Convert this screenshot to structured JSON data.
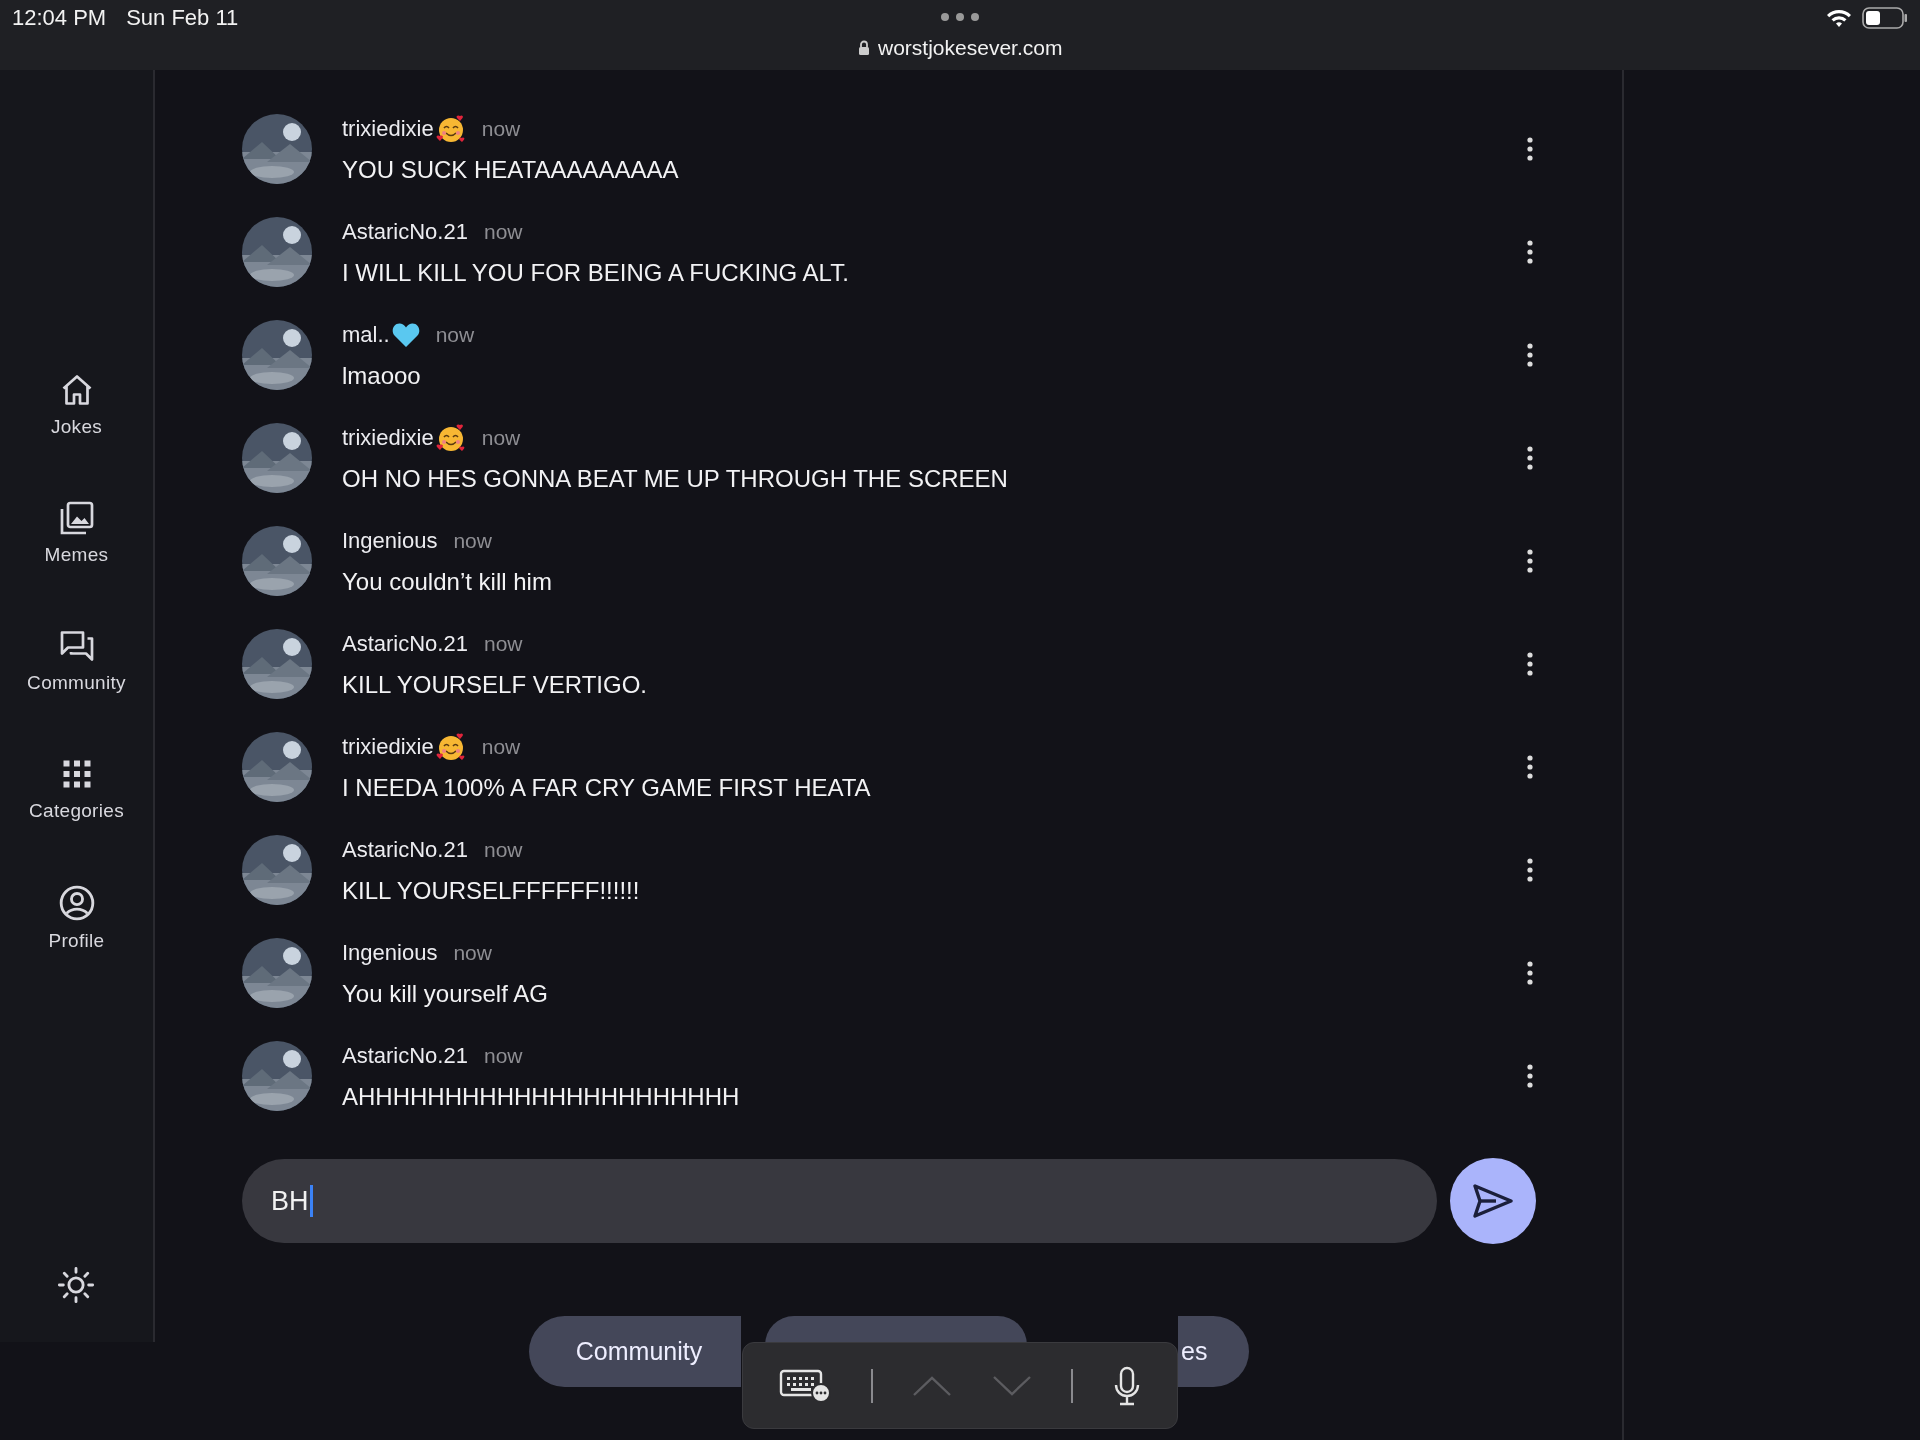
{
  "status_bar": {
    "time": "12:04 PM",
    "date": "Sun Feb 11",
    "url": "worstjokesever.com"
  },
  "sidebar": {
    "items": [
      {
        "label": "Jokes",
        "selected": false
      },
      {
        "label": "Memes",
        "selected": false
      },
      {
        "label": "Community",
        "selected": false
      },
      {
        "label": "Categories",
        "selected": false
      },
      {
        "label": "Profile",
        "selected": false
      }
    ]
  },
  "messages": [
    {
      "kind": "smiley",
      "author": "trixiedixie",
      "time": "now",
      "text": "YOU SUCK HEATAAAAAAAAA"
    },
    {
      "kind": "plain",
      "author": "AstaricNo.21",
      "time": "now",
      "text": "I WILL KILL YOU FOR BEING A FUCKING ALT."
    },
    {
      "kind": "heart",
      "author": "mal..",
      "time": "now",
      "text": "lmaooo"
    },
    {
      "kind": "smiley",
      "author": "trixiedixie",
      "time": "now",
      "text": "OH NO HES GONNA BEAT ME UP THROUGH THE SCREEN"
    },
    {
      "kind": "plain",
      "author": "Ingenious",
      "time": "now",
      "text": "You couldn’t kill him"
    },
    {
      "kind": "plain",
      "author": "AstaricNo.21",
      "time": "now",
      "text": "KILL YOURSELF VERTIGO."
    },
    {
      "kind": "smiley",
      "author": "trixiedixie",
      "time": "now",
      "text": "I NEEDA 100% A FAR CRY GAME FIRST HEATA"
    },
    {
      "kind": "plain",
      "author": "AstaricNo.21",
      "time": "now",
      "text": "KILL YOURSELFFFFFF!!!!!!"
    },
    {
      "kind": "plain",
      "author": "Ingenious",
      "time": "now",
      "text": "You kill yourself AG"
    },
    {
      "kind": "plain",
      "author": "AstaricNo.21",
      "time": "now",
      "text": "AHHHHHHHHHHHHHHHHHHHHHH"
    }
  ],
  "composer": {
    "value": "BH"
  },
  "chips": [
    {
      "kind": "labeled",
      "label": "Community"
    },
    {
      "kind": "hidden"
    },
    {
      "kind": "labeled",
      "label": "es"
    }
  ]
}
